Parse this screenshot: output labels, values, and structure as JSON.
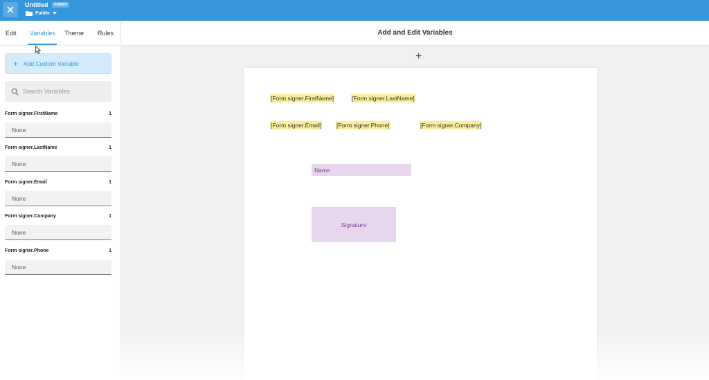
{
  "topbar": {
    "title": "Untitled",
    "badge": "FORMS",
    "folder": "Folder",
    "accent": "#3596db"
  },
  "tabs": [
    {
      "label": "Edit",
      "active": false
    },
    {
      "label": "Variables",
      "active": true
    },
    {
      "label": "Theme",
      "active": false
    },
    {
      "label": "Rules",
      "active": false
    }
  ],
  "sidebar": {
    "add_button": "Add Custom Variable",
    "search_placeholder": "Search Variables",
    "variables": [
      {
        "name": "Form signer.FirstName",
        "count": "1",
        "value": "None"
      },
      {
        "name": "Form signer.LastName",
        "count": "1",
        "value": "None"
      },
      {
        "name": "Form signer.Email",
        "count": "1",
        "value": "None"
      },
      {
        "name": "Form signer.Company",
        "count": "1",
        "value": "None"
      },
      {
        "name": "Form signer.Phone",
        "count": "1",
        "value": "None"
      }
    ]
  },
  "main": {
    "title": "Add and Edit Variables",
    "merge_fields": [
      "[Form signer.FirstName]",
      "[Form signer.LastName]",
      "[Form signer.Email]",
      "[Form signer.Phone]",
      "[Form signer.Company]"
    ],
    "name_field": "Name",
    "signature_field": "Signature"
  }
}
